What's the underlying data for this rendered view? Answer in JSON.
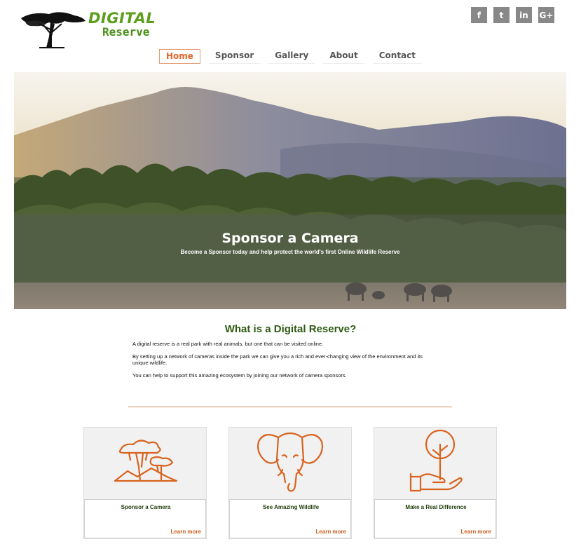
{
  "logo": {
    "line1": "DIGITAL",
    "line2": "Reserve"
  },
  "social": [
    {
      "icon": "facebook-icon",
      "glyph": "f"
    },
    {
      "icon": "twitter-icon",
      "glyph": "t"
    },
    {
      "icon": "linkedin-icon",
      "glyph": "in"
    },
    {
      "icon": "google-plus-icon",
      "glyph": "G+"
    }
  ],
  "nav": {
    "items": [
      "Home",
      "Sponsor",
      "Gallery",
      "About",
      "Contact"
    ],
    "active": "Home"
  },
  "hero": {
    "title": "Sponsor a Camera",
    "subtitle": "Become a Sponsor today and help protect the world's first Online Wildlife Reserve"
  },
  "about": {
    "title": "What is a Digital Reserve?",
    "paragraphs": [
      "A digital reserve is a real park with real animals, but one that can be visited online.",
      "By setting up a network of cameras inside the park we can give you a rich and ever-changing view of the environment and its unique wildlife.",
      "You can help to support this amazing ecosystem by joining our network of camera sponsors."
    ]
  },
  "cards": [
    {
      "title": "Sponsor a Camera",
      "link": "Learn more",
      "icon": "trees-icon"
    },
    {
      "title": "See Amazing Wildlife",
      "link": "Learn more",
      "icon": "elephant-icon"
    },
    {
      "title": "Make a Real Difference",
      "link": "Learn more",
      "icon": "hand-plant-icon"
    }
  ],
  "colors": {
    "accent": "#e0662a",
    "brand_green": "#5a9e1c",
    "dark_green": "#2c5a12",
    "icon_gray": "#888888"
  }
}
